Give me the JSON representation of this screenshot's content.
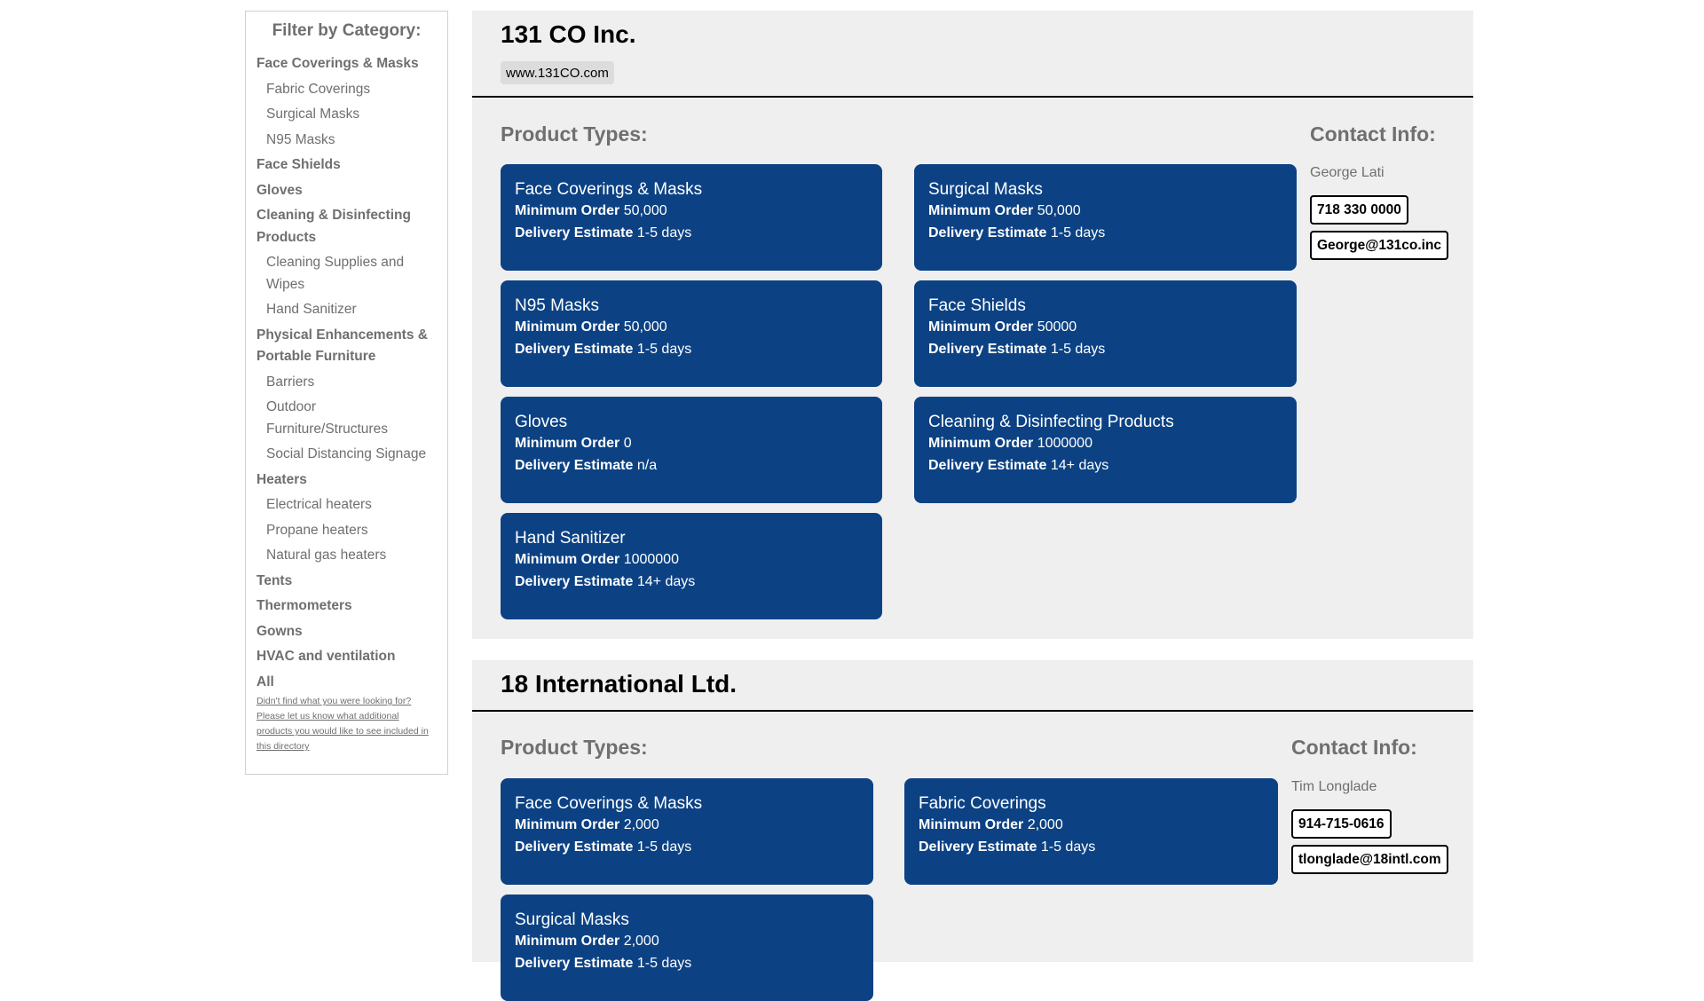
{
  "sidebar": {
    "title": "Filter by Category:",
    "categories": [
      {
        "label": "Face Coverings & Masks",
        "children": [
          "Fabric Coverings",
          "Surgical Masks",
          "N95 Masks"
        ]
      },
      {
        "label": "Face Shields",
        "children": []
      },
      {
        "label": "Gloves",
        "children": []
      },
      {
        "label": "Cleaning & Disinfecting Products",
        "children": [
          "Cleaning Supplies and Wipes",
          "Hand Sanitizer"
        ]
      },
      {
        "label": "Physical Enhancements & Portable Furniture",
        "children": [
          "Barriers",
          "Outdoor Furniture/Structures",
          "Social Distancing Signage"
        ]
      },
      {
        "label": "Heaters",
        "children": [
          "Electrical heaters",
          "Propane heaters",
          "Natural gas heaters"
        ]
      },
      {
        "label": "Tents",
        "children": []
      },
      {
        "label": "Thermometers",
        "children": []
      },
      {
        "label": "Gowns",
        "children": []
      },
      {
        "label": "HVAC and ventilation",
        "children": []
      },
      {
        "label": "All",
        "children": []
      }
    ],
    "note": "Didn't find what you were looking for? Please let us know what additional products you would like to see included in this directory"
  },
  "labels": {
    "min_order": "Minimum Order",
    "delivery": "Delivery Estimate",
    "product_types": "Product Types:",
    "contact_info": "Contact Info:"
  },
  "companies": [
    {
      "name": "131 CO Inc.",
      "website": "www.131CO.com",
      "contact": {
        "name": "George Lati",
        "phone": "718 330 0000",
        "email": "George@131co.inc"
      },
      "products": [
        {
          "title": "Face Coverings & Masks",
          "min": "50,000",
          "delivery": "1-5 days"
        },
        {
          "title": "Surgical Masks",
          "min": "50,000",
          "delivery": "1-5 days"
        },
        {
          "title": "N95 Masks",
          "min": "50,000",
          "delivery": "1-5 days"
        },
        {
          "title": "Face Shields",
          "min": "50000",
          "delivery": "1-5 days"
        },
        {
          "title": "Gloves",
          "min": "0",
          "delivery": "n/a"
        },
        {
          "title": "Cleaning & Disinfecting Products",
          "min": "1000000",
          "delivery": "14+ days"
        },
        {
          "title": "Hand Sanitizer",
          "min": "1000000",
          "delivery": "14+ days"
        }
      ]
    },
    {
      "name": "18 International Ltd.",
      "website": "",
      "contact": {
        "name": "Tim Longlade",
        "phone": "914-715-0616",
        "email": "tlonglade@18intl.com"
      },
      "products": [
        {
          "title": "Face Coverings & Masks",
          "min": "2,000",
          "delivery": "1-5 days"
        },
        {
          "title": "Fabric Coverings",
          "min": "2,000",
          "delivery": "1-5 days"
        },
        {
          "title": "Surgical Masks",
          "min": "2,000",
          "delivery": "1-5 days"
        }
      ]
    }
  ]
}
